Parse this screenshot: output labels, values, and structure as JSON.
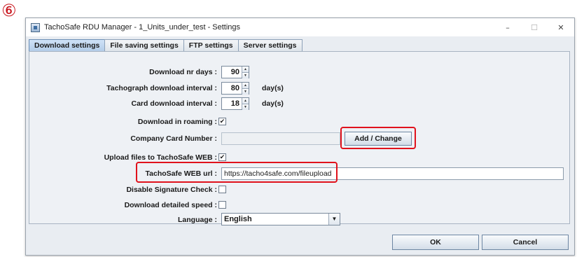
{
  "annotation": {
    "step": "⑥"
  },
  "window": {
    "title": "TachoSafe RDU Manager - 1_Units_under_test - Settings",
    "controls": {
      "minimize": "–",
      "maximize": "☐",
      "close": "✕"
    }
  },
  "tabs": [
    {
      "label": "Download settings",
      "active": true
    },
    {
      "label": "File saving settings"
    },
    {
      "label": "FTP settings"
    },
    {
      "label": "Server settings"
    }
  ],
  "form": {
    "download_nr_days": {
      "label": "Download nr days :",
      "value": "90"
    },
    "tachograph_interval": {
      "label": "Tachograph download interval :",
      "value": "80",
      "unit": "day(s)"
    },
    "card_interval": {
      "label": "Card download interval :",
      "value": "18",
      "unit": "day(s)"
    },
    "download_in_roaming": {
      "label": "Download in roaming :",
      "checked": true,
      "mark": "✔"
    },
    "company_card": {
      "label": "Company Card Number :",
      "value": "",
      "button": "Add / Change"
    },
    "upload_files": {
      "label": "Upload files to TachoSafe WEB :",
      "checked": true,
      "mark": "✔"
    },
    "web_url": {
      "label": "TachoSafe WEB url :",
      "value": "https://tacho4safe.com/fileupload"
    },
    "disable_signature": {
      "label": "Disable Signature Check :",
      "checked": false,
      "mark": ""
    },
    "detailed_speed": {
      "label": "Download detailed speed :",
      "checked": false,
      "mark": ""
    },
    "language": {
      "label": "Language :",
      "value": "English"
    }
  },
  "footer": {
    "ok": "OK",
    "cancel": "Cancel"
  },
  "icons": {
    "spinner_up": "▲",
    "spinner_down": "▼",
    "dropdown_arrow": "▼"
  },
  "colors": {
    "highlight": "#e0121c",
    "active_tab": "#b1cbe7"
  }
}
